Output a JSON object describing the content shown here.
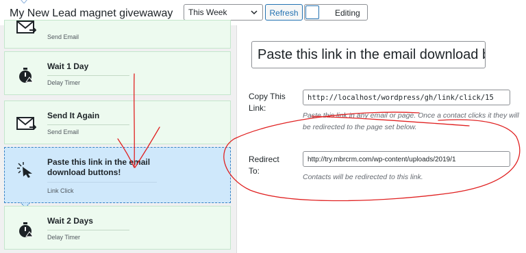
{
  "header": {
    "title": "My New Lead magnet givewaway",
    "period_select": "This Week",
    "refresh_label": "Refresh",
    "editing_label": "Editing"
  },
  "steps": [
    {
      "name": "",
      "type": "Send Email",
      "icon": "envelope-icon"
    },
    {
      "name": "Wait 1 Day",
      "type": "Delay Timer",
      "icon": "stopwatch-icon"
    },
    {
      "name": "Send It Again",
      "type": "Send Email",
      "icon": "envelope-icon"
    },
    {
      "name_line1": "Paste this link in the email",
      "name_line2": "download buttons!",
      "type": "Link Click",
      "icon": "cursor-click-icon",
      "active": true
    },
    {
      "name": "Wait 2 Days",
      "type": "Delay Timer",
      "icon": "stopwatch-icon"
    }
  ],
  "panel": {
    "link_title_value": "Paste this link in the email download b",
    "copy_label": "Copy This Link:",
    "copy_url": "http://localhost/wordpress/gh/link/click/15",
    "copy_desc": "Paste this link in any email or page. Once a contact clicks it they will be redirected to the page set below.",
    "redirect_label": "Redirect To:",
    "redirect_url": "http://try.mbrcrm.com/wp-content/uploads/2019/1",
    "redirect_desc": "Contacts will be redirected to this link."
  },
  "colors": {
    "step_bg": "#edfaef",
    "active_bg": "#cfe8fb",
    "accent": "#2271b1",
    "annotation": "#e02020"
  }
}
